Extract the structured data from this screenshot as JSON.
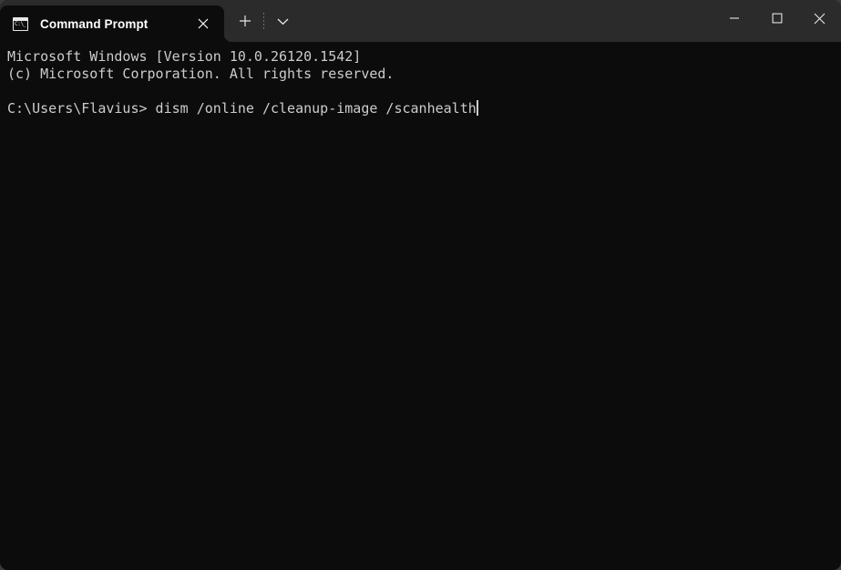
{
  "window": {
    "titlebar_color": "#2b2b2b",
    "body_color": "#0c0c0c",
    "text_color": "#cccccc"
  },
  "tab": {
    "title": "Command Prompt",
    "icon_name": "command-prompt-icon",
    "icon_glyph": "C:\\_",
    "close_label": "Close tab"
  },
  "tab_actions": {
    "new_tab_label": "+",
    "dropdown_label": "v"
  },
  "window_controls": {
    "minimize_label": "Minimize",
    "maximize_label": "Maximize",
    "close_label": "Close"
  },
  "terminal": {
    "lines": [
      "Microsoft Windows [Version 10.0.26120.1542]",
      "(c) Microsoft Corporation. All rights reserved.",
      "",
      "C:\\Users\\Flavius> dism /online /cleanup-image /scanhealth"
    ],
    "prompt": "C:\\Users\\Flavius>",
    "command": "dism /online /cleanup-image /scanhealth",
    "cursor_visible": "true"
  }
}
